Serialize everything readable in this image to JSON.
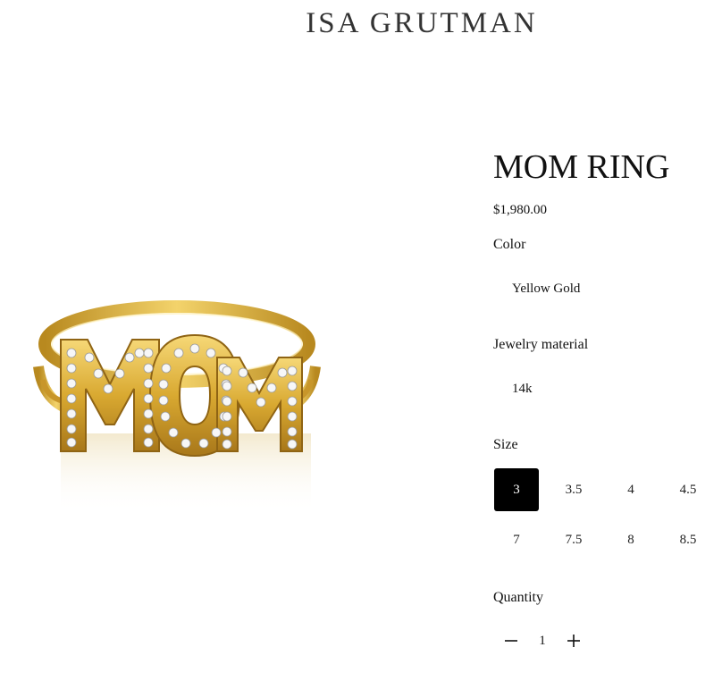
{
  "brand": {
    "name": "ISA GRUTMAN"
  },
  "product": {
    "title": "MOM RING",
    "price": "$1,980.00",
    "image_letters": "MOM"
  },
  "options": {
    "color": {
      "label": "Color",
      "value": "Yellow Gold"
    },
    "material": {
      "label": "Jewelry material",
      "value": "14k"
    },
    "size": {
      "label": "Size",
      "selected": "3",
      "values": [
        "3",
        "3.5",
        "4",
        "4.5",
        "7",
        "7.5",
        "8",
        "8.5"
      ]
    }
  },
  "quantity": {
    "label": "Quantity",
    "value": "1"
  },
  "colors": {
    "gold": "#d4a22a",
    "gold_dark": "#a8771a",
    "gold_light": "#f3d36b",
    "selected_bg": "#000000",
    "text": "#111111"
  }
}
